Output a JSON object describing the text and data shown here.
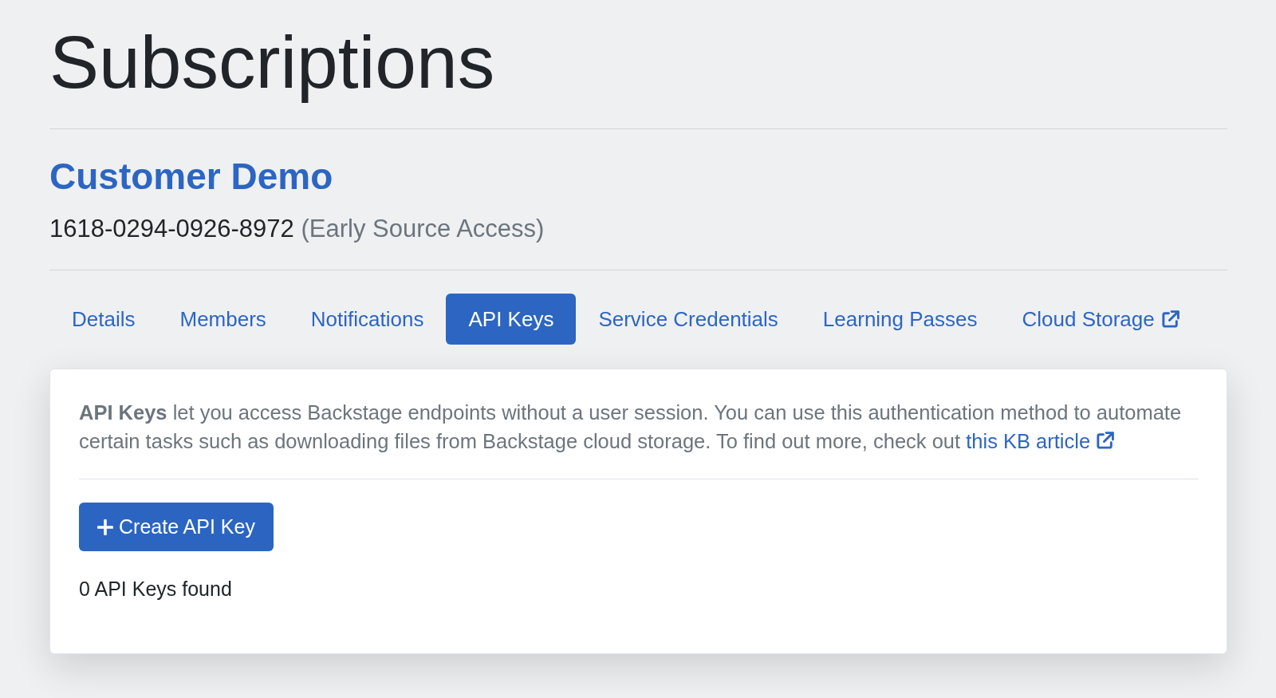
{
  "page": {
    "title": "Subscriptions"
  },
  "subscription": {
    "name": "Customer Demo",
    "number": "1618-0294-0926-8972",
    "plan": "(Early Source Access)"
  },
  "tabs": [
    {
      "label": "Details",
      "selected": false,
      "external": false
    },
    {
      "label": "Members",
      "selected": false,
      "external": false
    },
    {
      "label": "Notifications",
      "selected": false,
      "external": false
    },
    {
      "label": "API Keys",
      "selected": true,
      "external": false
    },
    {
      "label": "Service Credentials",
      "selected": false,
      "external": false
    },
    {
      "label": "Learning Passes",
      "selected": false,
      "external": false
    },
    {
      "label": "Cloud Storage",
      "selected": false,
      "external": true
    }
  ],
  "panel": {
    "description": {
      "text": "**API Keys** let you access Backstage endpoints without a user session. You can use this authentication method to automate certain tasks such as downloading files from Backstage cloud storage. To find out more, check out",
      "link": "this KB article"
    },
    "create_button": {
      "label": "Create API Key"
    },
    "result_count": "0 API Keys found"
  }
}
